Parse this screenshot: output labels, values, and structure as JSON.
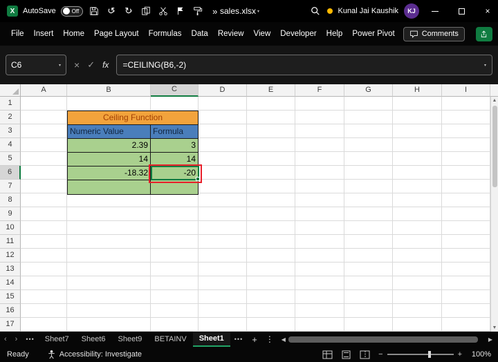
{
  "titlebar": {
    "autosave_label": "AutoSave",
    "autosave_state": "Off",
    "filename": "sales.xlsx",
    "user_name": "Kunal Jai Kaushik",
    "user_initials": "KJ"
  },
  "ribbon": {
    "tabs": [
      "File",
      "Insert",
      "Home",
      "Page Layout",
      "Formulas",
      "Data",
      "Review",
      "View",
      "Developer",
      "Help",
      "Power Pivot"
    ],
    "comments_label": "Comments"
  },
  "formula_bar": {
    "name_box": "C6",
    "fx_label": "fx",
    "formula": "=CEILING(B6,-2)"
  },
  "grid": {
    "columns": [
      "A",
      "B",
      "C",
      "D",
      "E",
      "F",
      "G",
      "H",
      "I"
    ],
    "rows": [
      "1",
      "2",
      "3",
      "4",
      "5",
      "6",
      "7",
      "8",
      "9",
      "10",
      "11",
      "12",
      "13",
      "14",
      "15",
      "16",
      "17"
    ],
    "selected_cell": "C6"
  },
  "table": {
    "title": "Ceiling Function",
    "col_headers": [
      "Numeric Value",
      "Formula"
    ],
    "rows": [
      [
        "2.39",
        "3"
      ],
      [
        "14",
        "14"
      ],
      [
        "-18.32",
        "-20"
      ],
      [
        "",
        ""
      ]
    ]
  },
  "sheet_bar": {
    "overflow_left": "•••",
    "tabs": [
      "Sheet7",
      "Sheet6",
      "Sheet9",
      "BETAINV"
    ],
    "active_tab": "Sheet1",
    "overflow_right": "•••"
  },
  "status_bar": {
    "mode": "Ready",
    "accessibility": "Accessibility: Investigate",
    "zoom_level": "100%"
  },
  "colors": {
    "table_title_orange": "#F2A33C",
    "table_header_blue": "#4A7EBB",
    "table_cell_green": "#A9D08E",
    "excel_green": "#107C41",
    "annotation_red": "#E8202A",
    "active_tab_underline": "#21A366",
    "avatar_purple": "#5B2D90",
    "presence_yellow": "#FFB900"
  }
}
